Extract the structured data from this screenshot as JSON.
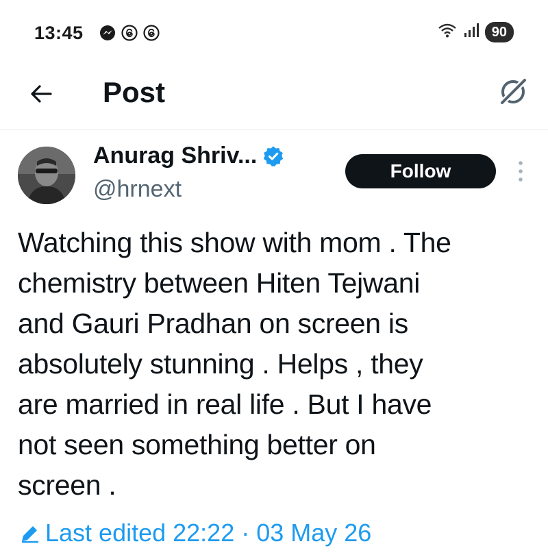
{
  "status_bar": {
    "time": "13:45",
    "left_icons": [
      "messenger-icon",
      "threads-icon",
      "threads-icon"
    ],
    "battery": "90"
  },
  "header": {
    "title": "Post",
    "back_icon": "arrow-left-icon",
    "grok_icon": "grok-icon"
  },
  "post": {
    "author_name": "Anurag Shriv...",
    "handle": "@hrnext",
    "verified": true,
    "follow_label": "Follow",
    "text_lines": [
      "Watching this show with mom . The",
      "chemistry between Hiten Tejwani",
      "and Gauri Pradhan on screen is",
      "absolutely stunning . Helps , they",
      "are married in real life . But I have",
      "not seen something better on",
      "screen ."
    ],
    "edited_label": "Last edited 22:22 · 03 May 26"
  },
  "colors": {
    "accent": "#1d9bf0",
    "text": "#0f1419",
    "secondary": "#536471",
    "follow_bg": "#0f1419"
  }
}
